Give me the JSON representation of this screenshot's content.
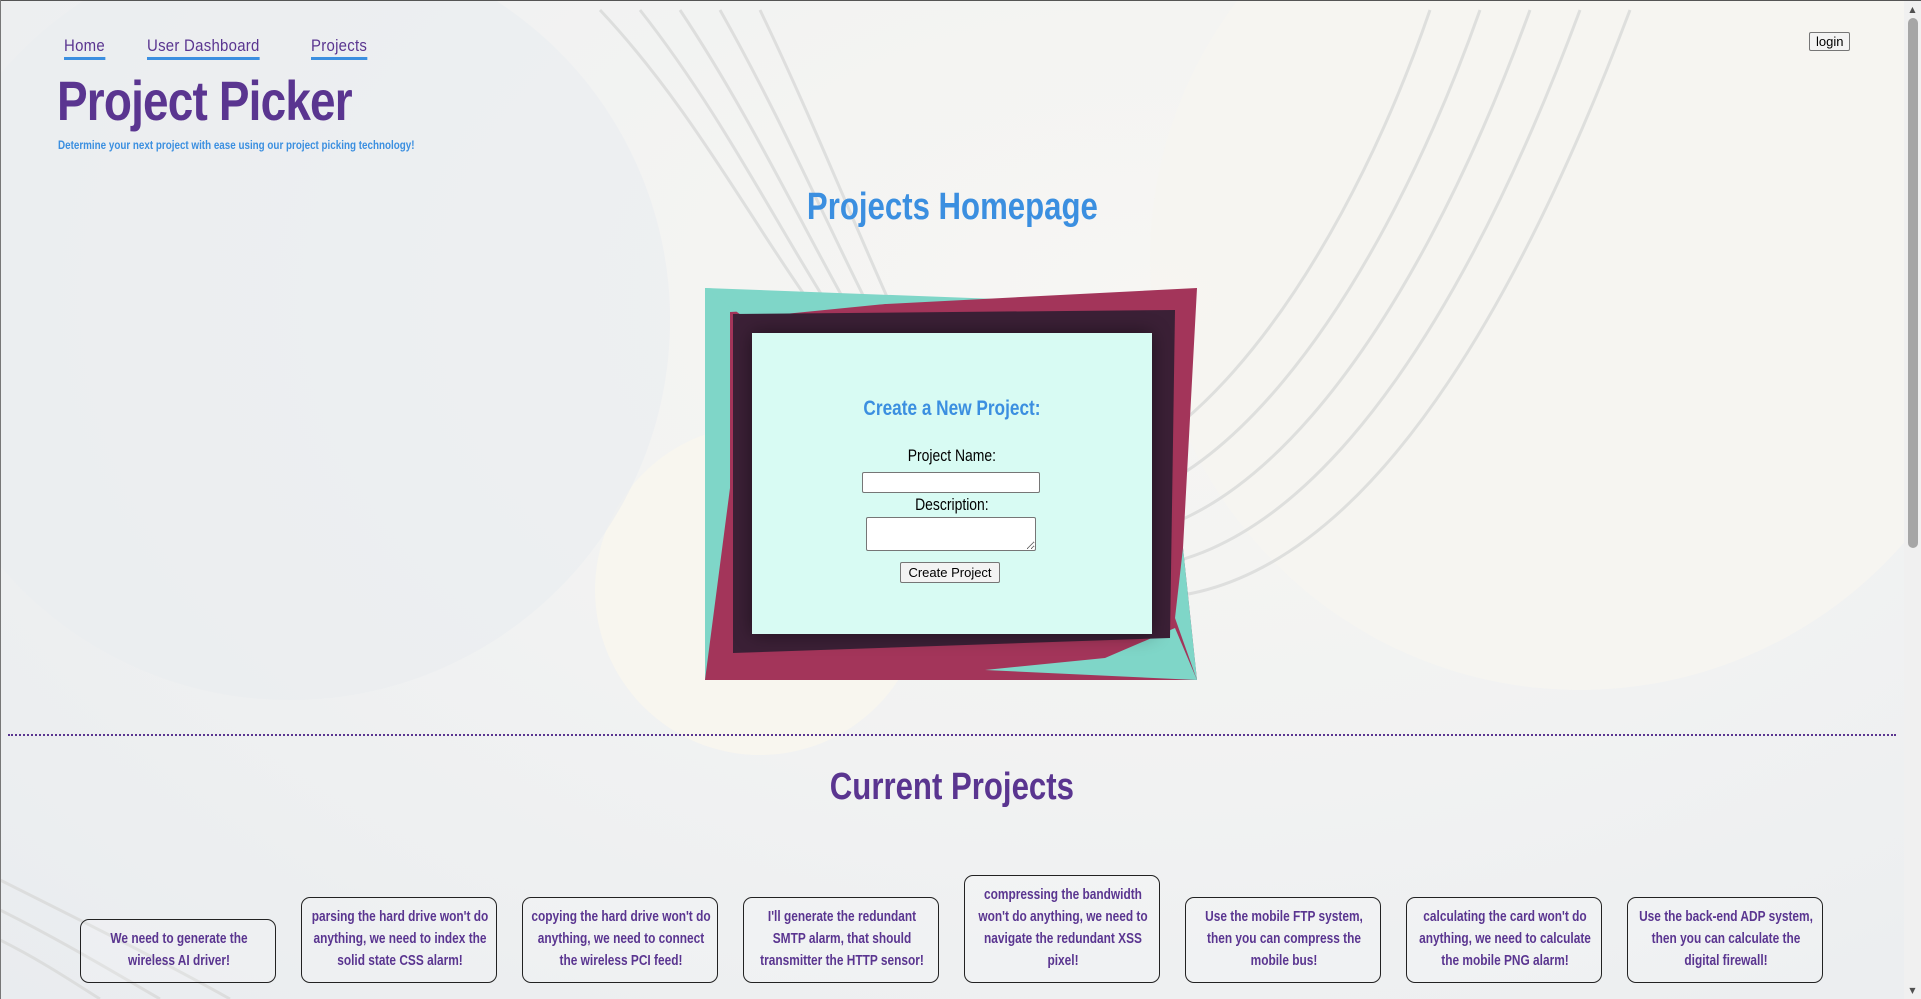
{
  "nav": {
    "items": [
      {
        "label": "Home"
      },
      {
        "label": "User Dashboard"
      },
      {
        "label": "Projects"
      }
    ],
    "login_label": "login"
  },
  "site": {
    "title": "Project Picker",
    "tagline": "Determine your next project with ease using our project picking technology!"
  },
  "page_heading": "Projects Homepage",
  "create_form": {
    "title": "Create a New Project:",
    "name_label": "Project Name:",
    "name_value": "",
    "description_label": "Description:",
    "description_value": "",
    "submit_label": "Create Project"
  },
  "projects_section": {
    "heading": "Current Projects",
    "projects": [
      {
        "description": "We need to generate the wireless AI driver!"
      },
      {
        "description": "parsing the hard drive won't do anything, we need to index the solid state CSS alarm!"
      },
      {
        "description": "copying the hard drive won't do anything, we need to connect the wireless PCI feed!"
      },
      {
        "description": "I'll generate the redundant SMTP alarm, that should transmitter the HTTP sensor!"
      },
      {
        "description": "compressing the bandwidth won't do anything, we need to navigate the redundant XSS pixel!"
      },
      {
        "description": "Use the mobile FTP system, then you can compress the mobile bus!"
      },
      {
        "description": "calculating the card won't do anything, we need to calculate the mobile PNG alarm!"
      },
      {
        "description": "Use the back-end ADP system, then you can calculate the digital firewall!"
      }
    ]
  },
  "colors": {
    "brand_purple": "#5a3590",
    "accent_blue": "#3b8fe0",
    "card_bg": "#d8fbf3",
    "teal": "#7fd6c8",
    "crimson": "#a3355a",
    "plum": "#3b2036"
  }
}
